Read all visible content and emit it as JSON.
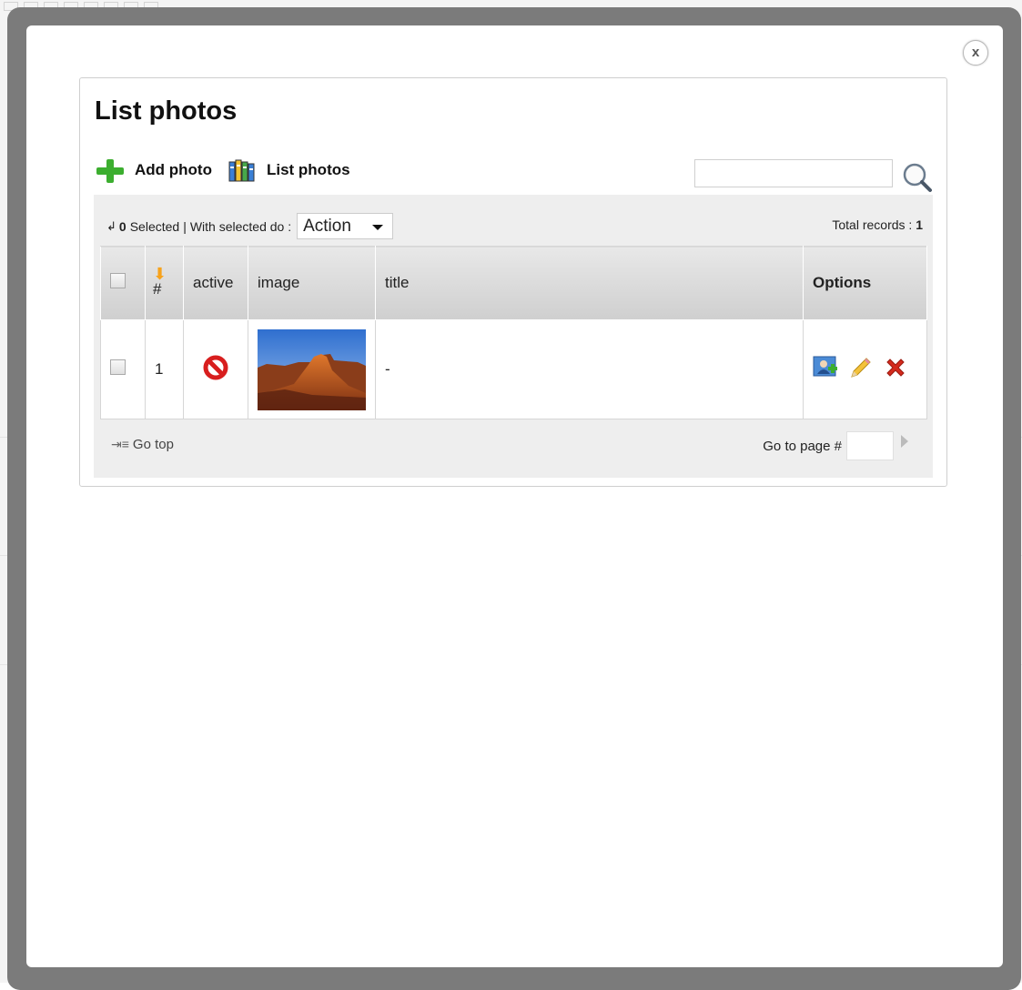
{
  "window": {
    "close_label": "x"
  },
  "page": {
    "title": "List photos"
  },
  "nav": [
    {
      "label": "Add photo",
      "icon": "plus-icon"
    },
    {
      "label": "List photos",
      "icon": "books-icon"
    }
  ],
  "search": {
    "value": "",
    "icon": "search-icon"
  },
  "selection": {
    "count": "0",
    "selected_label": "Selected",
    "separator": "|",
    "with_selected_label": "With selected do :",
    "action_value": "Action"
  },
  "total": {
    "label": "Total records :",
    "value": "1"
  },
  "table": {
    "headers": {
      "hash": "#",
      "active": "active",
      "image": "image",
      "title": "title",
      "options": "Options"
    },
    "rows": [
      {
        "id": "1",
        "active_icon": "blocked-icon",
        "image_alt": "desert mesa photo",
        "title": "-",
        "options": [
          "view-photo-icon",
          "edit-pencil-icon",
          "delete-x-icon"
        ]
      }
    ]
  },
  "footer": {
    "go_top": "Go top",
    "go_to_page": "Go to page #",
    "page_value": ""
  },
  "colors": {
    "overlay": "#7b7b7b",
    "accent_green": "#3cae2f",
    "delete_red": "#d42a1d",
    "blocked_red": "#d81e1e",
    "sort_orange": "#f7a21b"
  }
}
